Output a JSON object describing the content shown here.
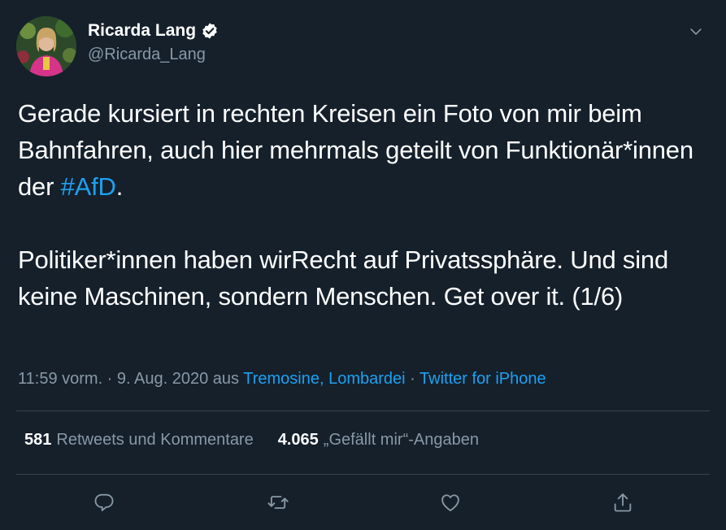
{
  "author": {
    "display_name": "Ricarda Lang",
    "handle": "@Ricarda_Lang",
    "verified_icon": "verified-badge-icon"
  },
  "tweet": {
    "paragraph1_text": "Gerade kursiert in rechten Kreisen ein Foto von mir beim Bahnfahren, auch hier mehrmals geteilt von Funktionär*innen der ",
    "hashtag": "#AfD",
    "paragraph1_end": ".",
    "paragraph2_text": "Politiker*innen haben wirRecht auf Privatssphäre. Und sind keine Maschinen, sondern Menschen. Get over it. (1/6)"
  },
  "meta": {
    "time": "11:59 vorm.",
    "separator1": " · ",
    "date": "9. Aug. 2020",
    "from_text": " aus ",
    "location": "Tremosine, Lombardei",
    "separator2": " · ",
    "source": "Twitter for iPhone"
  },
  "stats": {
    "retweets_count": "581",
    "retweets_label": "Retweets und Kommentare",
    "likes_count": "4.065",
    "likes_label": "„Gefällt mir“-Angaben"
  },
  "actions": {
    "reply_icon": "reply-icon",
    "retweet_icon": "retweet-icon",
    "like_icon": "heart-icon",
    "share_icon": "share-icon"
  },
  "colors": {
    "background": "#15202b",
    "accent": "#1da1f2",
    "secondary_text": "#8899a6",
    "divider": "#38444d"
  }
}
